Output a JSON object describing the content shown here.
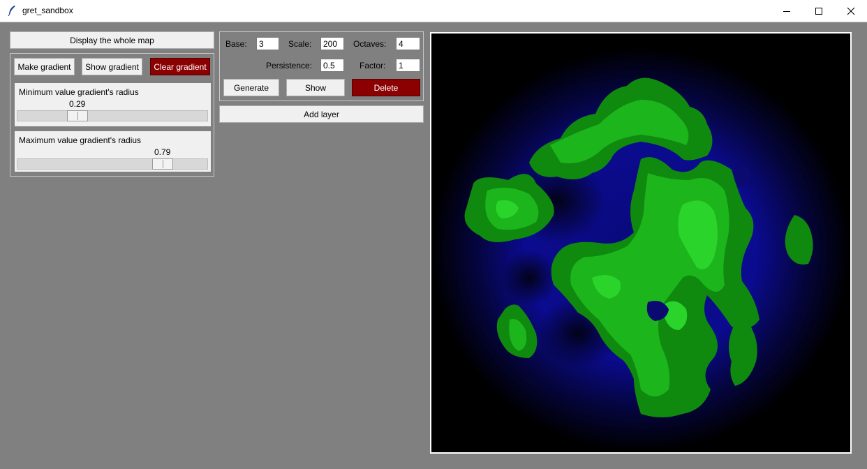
{
  "window": {
    "title": "gret_sandbox",
    "icon": "feather-icon"
  },
  "left_panel": {
    "display_whole_map_label": "Display the whole map",
    "gradient": {
      "make_label": "Make gradient",
      "show_label": "Show gradient",
      "clear_label": "Clear gradient",
      "min_slider": {
        "label": "Minimum value gradient's radius",
        "value": "0.29",
        "fraction": 0.29
      },
      "max_slider": {
        "label": "Maximum value gradient's radius",
        "value": "0.79",
        "fraction": 0.79
      }
    }
  },
  "layer": {
    "base_label": "Base:",
    "base_value": "3",
    "scale_label": "Scale:",
    "scale_value": "200",
    "octaves_label": "Octaves:",
    "octaves_value": "4",
    "persistence_label": "Persistence:",
    "persistence_value": "0.5",
    "factor_label": "Factor:",
    "factor_value": "1",
    "generate_label": "Generate",
    "show_label": "Show",
    "delete_label": "Delete"
  },
  "add_layer_label": "Add layer",
  "colors": {
    "background": "#808080",
    "danger_button": "#8b0000",
    "map_ocean_deep": "#000000",
    "map_ocean": "#0a0a8a",
    "map_land": "#1aa51a",
    "map_land_light": "#2ad42a"
  }
}
